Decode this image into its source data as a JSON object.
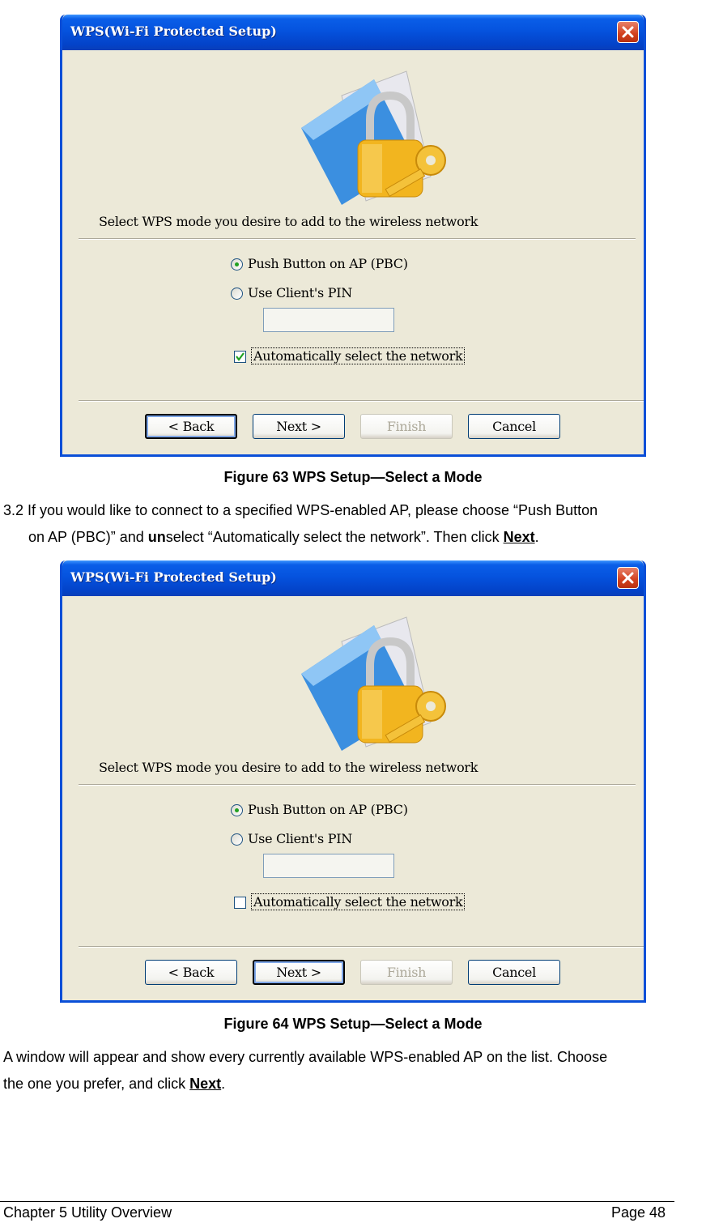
{
  "figures": [
    {
      "title": "WPS(Wi-Fi Protected Setup)",
      "prompt": "Select WPS mode you desire to add to the wireless network",
      "radio_pbc": "Push Button on AP (PBC)",
      "radio_pin": "Use Client's PIN",
      "pin_value": "",
      "checkbox_label": "Automatically select the network",
      "checkbox_checked": true,
      "selected_mode": "Push Button on AP (PBC)",
      "default_button": "Back",
      "buttons": {
        "back": "< Back",
        "next": "Next >",
        "finish": "Finish",
        "cancel": "Cancel"
      },
      "caption": "Figure 63 WPS Setup—Select a Mode"
    },
    {
      "title": "WPS(Wi-Fi Protected Setup)",
      "prompt": "Select WPS mode you desire to add to the wireless network",
      "radio_pbc": "Push Button on AP (PBC)",
      "radio_pin": "Use Client's PIN",
      "pin_value": "",
      "checkbox_label": "Automatically select the network",
      "checkbox_checked": false,
      "selected_mode": "Push Button on AP (PBC)",
      "default_button": "Next",
      "buttons": {
        "back": "< Back",
        "next": "Next >",
        "finish": "Finish",
        "cancel": "Cancel"
      },
      "caption": "Figure 64 WPS Setup—Select a Mode"
    }
  ],
  "paragraph1": {
    "line1": "3.2 If you would like to connect to a specified WPS-enabled AP, please choose “Push Button",
    "line2_a": "on AP (PBC)” and ",
    "line2_bold": "un",
    "line2_b": "select “Automatically select the network”. Then click ",
    "line2_link": "Next",
    "line2_end": "."
  },
  "paragraph2": {
    "line1": "A window will appear and show every currently available WPS-enabled AP on the list. Choose",
    "line2_a": "the one you prefer, and click ",
    "line2_link": "Next",
    "line2_end": "."
  },
  "footer": {
    "left": "Chapter 5 Utility Overview",
    "right": "Page 48"
  },
  "icons": {
    "illustration": "folder-padlock-key-icon",
    "close": "close-icon"
  },
  "colors": {
    "titlebar": "#0553de",
    "window_bg": "#ece9d8",
    "close_button": "#d2401e",
    "radio_dot": "#21a121"
  }
}
